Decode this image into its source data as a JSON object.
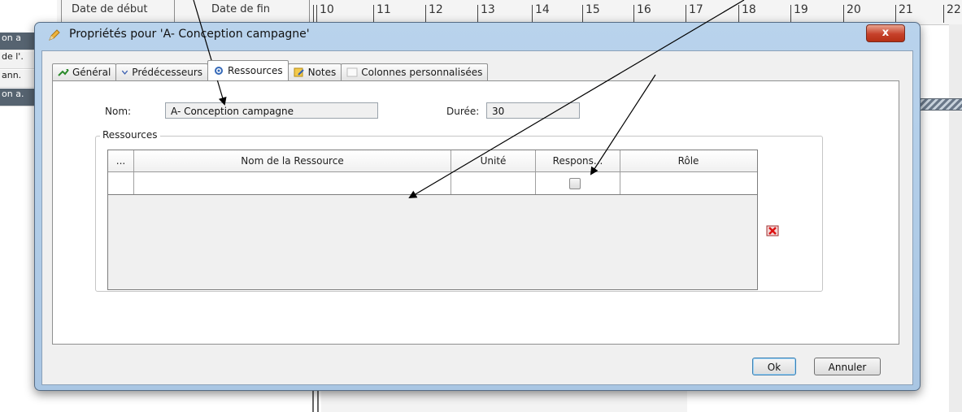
{
  "background": {
    "column_headers": [
      "Date de début",
      "Date de fin"
    ],
    "days": [
      "10",
      "11",
      "12",
      "13",
      "14",
      "15",
      "16",
      "17",
      "18",
      "19",
      "20",
      "21",
      "22"
    ],
    "side_rows": [
      "on a",
      "de l'.",
      "ann.",
      "on a."
    ]
  },
  "dialog": {
    "title": "Propriétés pour 'A- Conception campagne'",
    "close_label": "x",
    "tabs": [
      {
        "label": "Général",
        "icon": "general-icon"
      },
      {
        "label": "Prédécesseurs",
        "icon": "predecessors-icon"
      },
      {
        "label": "Ressources",
        "icon": "resources-icon"
      },
      {
        "label": "Notes",
        "icon": "notes-icon"
      },
      {
        "label": "Colonnes personnalisées",
        "icon": "custom-columns-icon"
      }
    ],
    "active_tab": "Ressources",
    "name_label": "Nom:",
    "name_value": "A- Conception campagne",
    "duration_label": "Durée:",
    "duration_value": "30",
    "resources_group_title": "Ressources",
    "table": {
      "columns": [
        "...",
        "Nom de la Ressource",
        "Unité",
        "Respons...",
        "Rôle"
      ],
      "rows": [
        {
          "index": "",
          "name": "",
          "unit": "",
          "responsible": false,
          "role": ""
        }
      ]
    },
    "delete_icon": "delete-icon",
    "ok_label": "Ok",
    "cancel_label": "Annuler"
  },
  "colors": {
    "title_bar": "#b9d3ec",
    "close_button": "#c6412a",
    "client_bg": "#f0f0f0"
  }
}
